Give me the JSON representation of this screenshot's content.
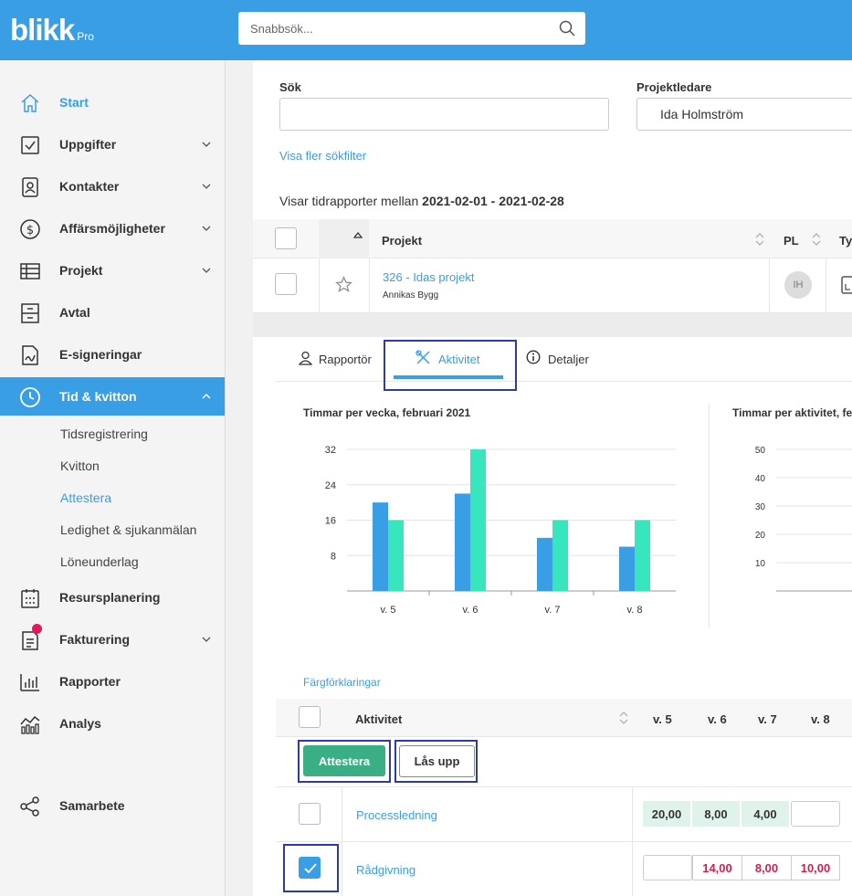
{
  "brand": {
    "name": "blikk",
    "suffix": "Pro"
  },
  "search": {
    "placeholder": "Snabbsök..."
  },
  "sidebar": {
    "items": [
      {
        "label": "Start"
      },
      {
        "label": "Uppgifter"
      },
      {
        "label": "Kontakter"
      },
      {
        "label": "Affärsmöjligheter"
      },
      {
        "label": "Projekt"
      },
      {
        "label": "Avtal"
      },
      {
        "label": "E-signeringar"
      },
      {
        "label": "Tid & kvitton"
      },
      {
        "label": "Resursplanering"
      },
      {
        "label": "Fakturering"
      },
      {
        "label": "Rapporter"
      },
      {
        "label": "Analys"
      },
      {
        "label": "Samarbete"
      }
    ],
    "sub_items": [
      {
        "label": "Tidsregistrering"
      },
      {
        "label": "Kvitton"
      },
      {
        "label": "Attestera"
      },
      {
        "label": "Ledighet & sjukanmälan"
      },
      {
        "label": "Löneunderlag"
      }
    ]
  },
  "filters": {
    "search_label": "Sök",
    "manager_label": "Projektledare",
    "manager_value": "Ida Holmström",
    "more_filters": "Visa fler sökfilter"
  },
  "range": {
    "prefix": "Visar tidrapporter mellan",
    "dates": "2021-02-01 - 2021-02-28"
  },
  "project_table": {
    "headers": {
      "project": "Projekt",
      "pl": "PL",
      "type": "Ty"
    },
    "row": {
      "name": "326 - Idas projekt",
      "customer": "Annikas Bygg",
      "pl_initials": "IH"
    }
  },
  "tabs": [
    {
      "label": "Rapportör"
    },
    {
      "label": "Aktivitet"
    },
    {
      "label": "Detaljer"
    }
  ],
  "charts": {
    "legend_link": "Färgförklaringar"
  },
  "chart_data": [
    {
      "type": "bar",
      "title": "Timmar per vecka, februari 2021",
      "categories": [
        "v. 5",
        "v. 6",
        "v. 7",
        "v. 8"
      ],
      "series": [
        {
          "color": "#3a9ee4",
          "values": [
            20,
            22,
            12,
            10
          ]
        },
        {
          "color": "#37e6bd",
          "values": [
            16,
            32,
            16,
            16
          ]
        }
      ],
      "yticks": [
        8,
        16,
        24,
        32
      ],
      "ylim": [
        0,
        32
      ]
    },
    {
      "type": "bar",
      "title": "Timmar per aktivitet, fe",
      "yticks": [
        10,
        20,
        30,
        40,
        50
      ],
      "ylim": [
        0,
        50
      ]
    }
  ],
  "activity_table": {
    "header": "Aktivitet",
    "weeks": [
      "v. 5",
      "v. 6",
      "v. 7",
      "v. 8"
    ],
    "approve_label": "Attestera",
    "unlock_label": "Lås upp",
    "rows": [
      {
        "name": "Processledning",
        "values": [
          "20,00",
          "8,00",
          "4,00",
          ""
        ],
        "checked": false
      },
      {
        "name": "Rådgivning",
        "values": [
          "",
          "14,00",
          "8,00",
          "10,00"
        ],
        "checked": true
      }
    ]
  },
  "colors": {
    "brand": "#3a9ee4",
    "approve": "#3aae84",
    "unapproved": "#d01f4e",
    "series_b": "#37e6bd"
  }
}
